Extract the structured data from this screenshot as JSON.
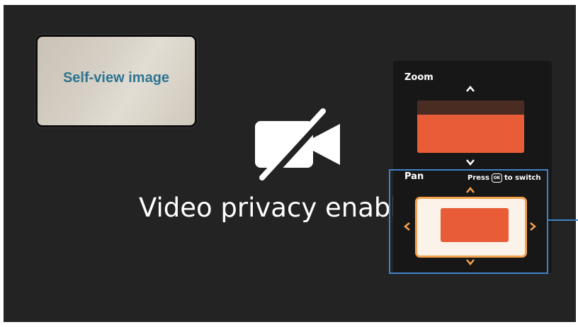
{
  "self_view": {
    "label": "Self-view image"
  },
  "privacy": {
    "message": "Video privacy enabled",
    "icon": "camera-off-icon"
  },
  "zoom": {
    "label": "Zoom",
    "level": 0.73,
    "up_icon": "chevron-up-icon",
    "down_icon": "chevron-down-icon"
  },
  "pan": {
    "label": "Pan",
    "hint_prefix": "Press",
    "hint_key": "OK",
    "hint_suffix": "to switch",
    "icons": [
      "chevron-up-icon",
      "chevron-down-icon",
      "chevron-left-icon",
      "chevron-right-icon"
    ]
  },
  "colors": {
    "background": "#232323",
    "panel": "#171717",
    "accent_orange": "#e85d38",
    "frame_orange": "#f4a24d",
    "callout_blue": "#3d83c8",
    "label_teal": "#2e7490"
  }
}
